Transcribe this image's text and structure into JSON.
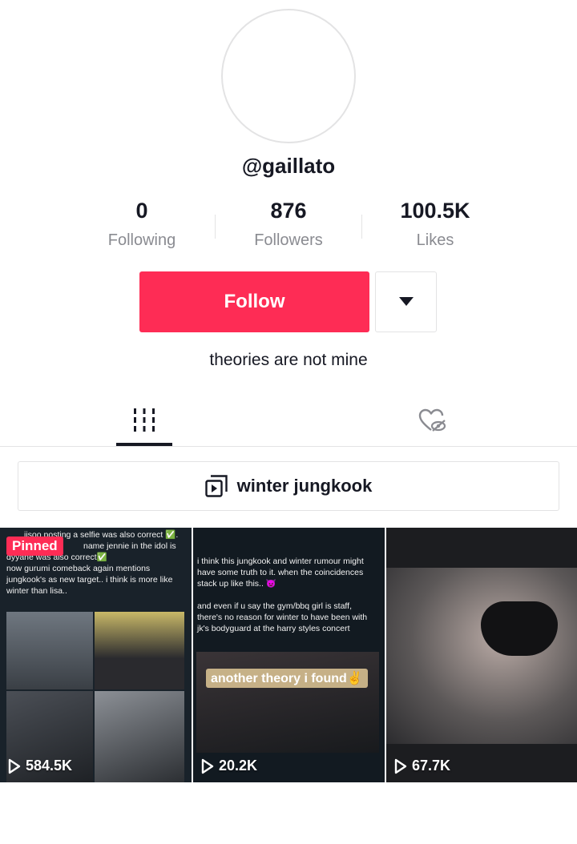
{
  "profile": {
    "username": "@gaillato",
    "bio": "theories are not mine"
  },
  "stats": [
    {
      "value": "0",
      "label": "Following"
    },
    {
      "value": "876",
      "label": "Followers"
    },
    {
      "value": "100.5K",
      "label": "Likes"
    }
  ],
  "actions": {
    "follow_label": "Follow",
    "more_icon": "caret-down-icon"
  },
  "tabs": [
    {
      "icon": "videos-grid-icon",
      "active": true
    },
    {
      "icon": "liked-private-icon",
      "active": false
    }
  ],
  "playlist": {
    "icon": "playlist-icon",
    "label": "winter jungkook"
  },
  "videos": [
    {
      "pinned_label": "Pinned",
      "views": "584.5K",
      "caption_lines": [
        "jisoo posting a selfie was also correct ✅.",
        "name jennie in the idol is",
        "dyyane was also correct✅",
        "now gurumi comeback again mentions",
        "jungkook's as new target.. i think is more like",
        "winter than lisa.."
      ]
    },
    {
      "views": "20.2K",
      "caption_lines": [
        "i think this jungkook and winter rumour might",
        "have some truth to it. when the coincidences",
        "stack up like this.. 👿",
        "",
        "and even if u say the gym/bbq girl is staff,",
        "there's no reason for winter to have been with",
        "jk's bodyguard at the harry styles concert"
      ],
      "overlay_text": "another theory i found✌️"
    },
    {
      "views": "67.7K"
    }
  ],
  "colors": {
    "accent": "#fe2c55",
    "text_primary": "#161823",
    "text_secondary": "#8a8b91",
    "border": "#e3e3e4"
  }
}
